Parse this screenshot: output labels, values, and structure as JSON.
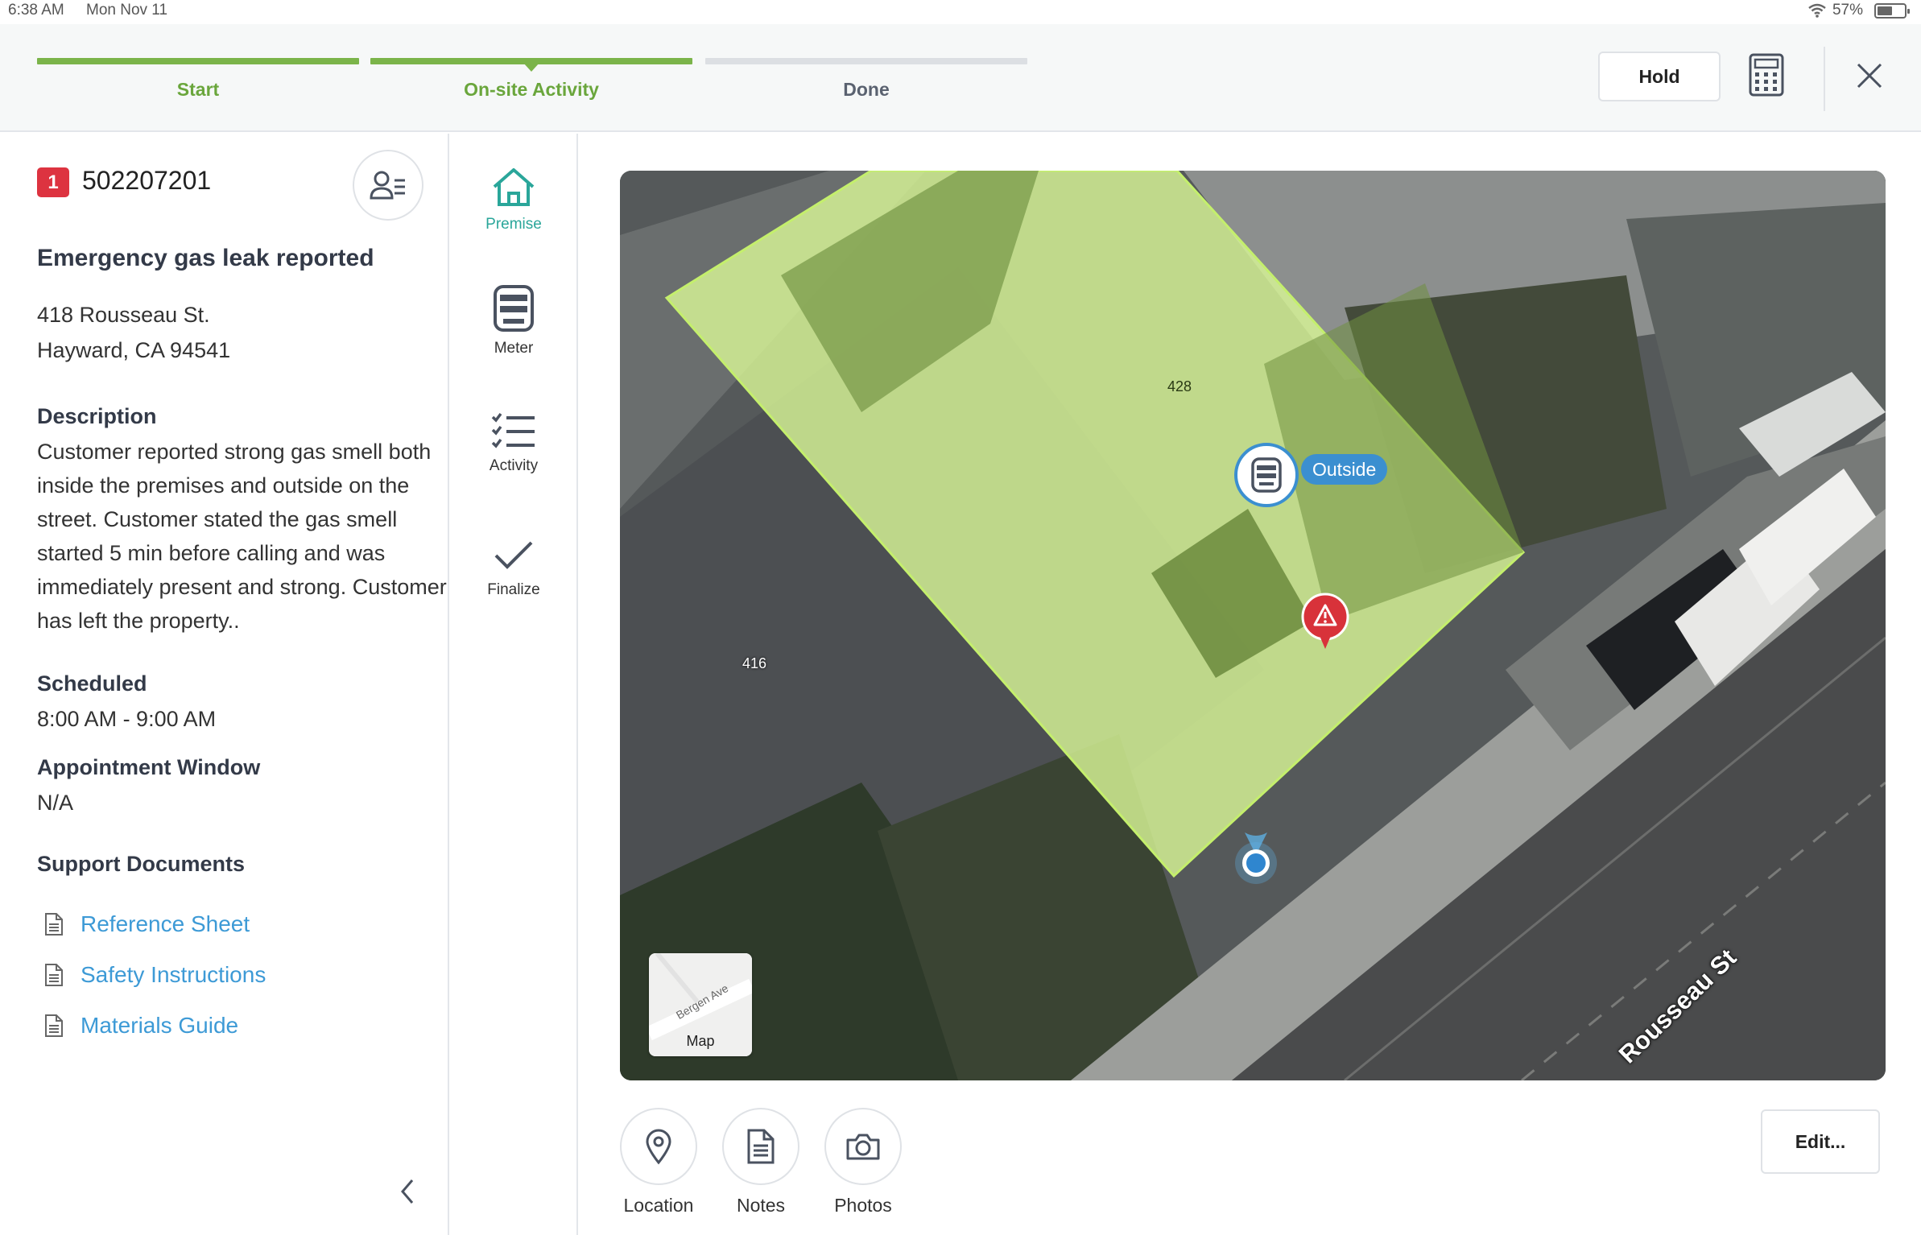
{
  "status_bar": {
    "time": "6:38 AM",
    "date": "Mon Nov 11",
    "battery": "57%",
    "battery_level": 0.57
  },
  "progress": {
    "steps": [
      {
        "label": "Start",
        "state": "complete"
      },
      {
        "label": "On-site Activity",
        "state": "current"
      },
      {
        "label": "Done",
        "state": "pending"
      }
    ]
  },
  "header": {
    "hold_label": "Hold",
    "calculator_icon": "calculator-icon",
    "close_icon": "close-icon"
  },
  "order": {
    "priority": "1",
    "number": "502207201",
    "title": "Emergency gas leak reported",
    "address_line1": "418 Rousseau St.",
    "address_line2": "Hayward, CA 94541",
    "description_heading": "Description",
    "description": "Customer reported strong gas smell both inside the premises and outside on the street. Customer stated the gas smell started 5 min before calling and was immediately present and strong. Customer has left the property..",
    "scheduled_heading": "Scheduled",
    "scheduled_value": "8:00 AM - 9:00 AM",
    "appointment_heading": "Appointment Window",
    "appointment_value": "N/A",
    "documents_heading": "Support Documents",
    "documents": [
      "Reference Sheet",
      "Safety Instructions",
      "Materials Guide"
    ]
  },
  "nav": {
    "items": [
      {
        "label": "Premise",
        "icon": "house-icon",
        "active": true
      },
      {
        "label": "Meter",
        "icon": "meter-icon",
        "active": false
      },
      {
        "label": "Activity",
        "icon": "checklist-icon",
        "active": false
      },
      {
        "label": "Finalize",
        "icon": "checkmark-icon",
        "active": false
      }
    ]
  },
  "map": {
    "parcel_label_1": "428",
    "parcel_label_2": "416",
    "meter_tag": "Outside",
    "street_name": "Rousseau St",
    "toggle_street": "Bergen Ave",
    "toggle_label": "Map"
  },
  "actions": {
    "location": "Location",
    "notes": "Notes",
    "photos": "Photos",
    "edit": "Edit..."
  },
  "colors": {
    "accent_green": "#7bb44a",
    "teal": "#2aa69a",
    "link_blue": "#3d9ad6",
    "priority_red": "#dd3340",
    "pin_blue": "#3b8fd0"
  }
}
